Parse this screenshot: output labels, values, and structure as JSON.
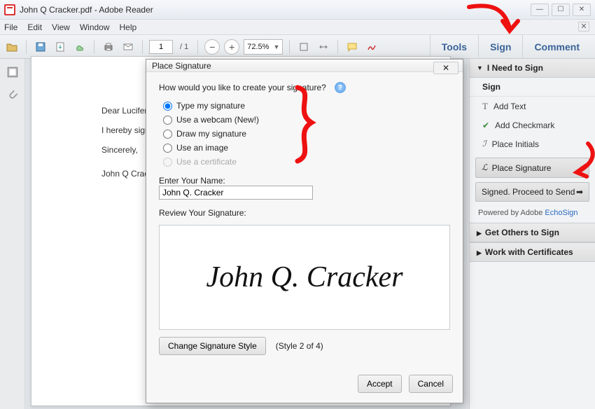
{
  "titlebar": {
    "title": "John Q Cracker.pdf - Adobe Reader"
  },
  "menu": {
    "file": "File",
    "edit": "Edit",
    "view": "View",
    "window": "Window",
    "help": "Help"
  },
  "toolbar": {
    "page_current": "1",
    "page_total": "/ 1",
    "zoom": "72.5%"
  },
  "right_tabs": {
    "tools": "Tools",
    "sign": "Sign",
    "comment": "Comment"
  },
  "document": {
    "line1": "Dear Lucifer,",
    "line2": "I hereby sign over my",
    "line3": "Sincerely,",
    "line4": "John Q Cracker"
  },
  "right_panel": {
    "heading1": "I Need to Sign",
    "sub_sign": "Sign",
    "add_text": "Add Text",
    "add_check": "Add Checkmark",
    "place_initials": "Place Initials",
    "place_signature": "Place Signature",
    "signed_send": "Signed. Proceed to Send",
    "powered": "Powered by Adobe ",
    "powered_link": "EchoSign",
    "heading2": "Get Others to Sign",
    "heading3": "Work with Certificates"
  },
  "dialog": {
    "title": "Place Signature",
    "prompt": "How would you like to create your signature?",
    "opt_type": "Type my signature",
    "opt_webcam": "Use a webcam (New!)",
    "opt_draw": "Draw my signature",
    "opt_image": "Use an image",
    "opt_cert": "Use a certificate",
    "enter_name": "Enter Your Name:",
    "name_value": "John Q. Cracker",
    "review": "Review Your Signature:",
    "sig_preview": "John Q. Cracker",
    "change_style": "Change Signature Style",
    "style_of": "(Style 2 of 4)",
    "accept": "Accept",
    "cancel": "Cancel"
  }
}
